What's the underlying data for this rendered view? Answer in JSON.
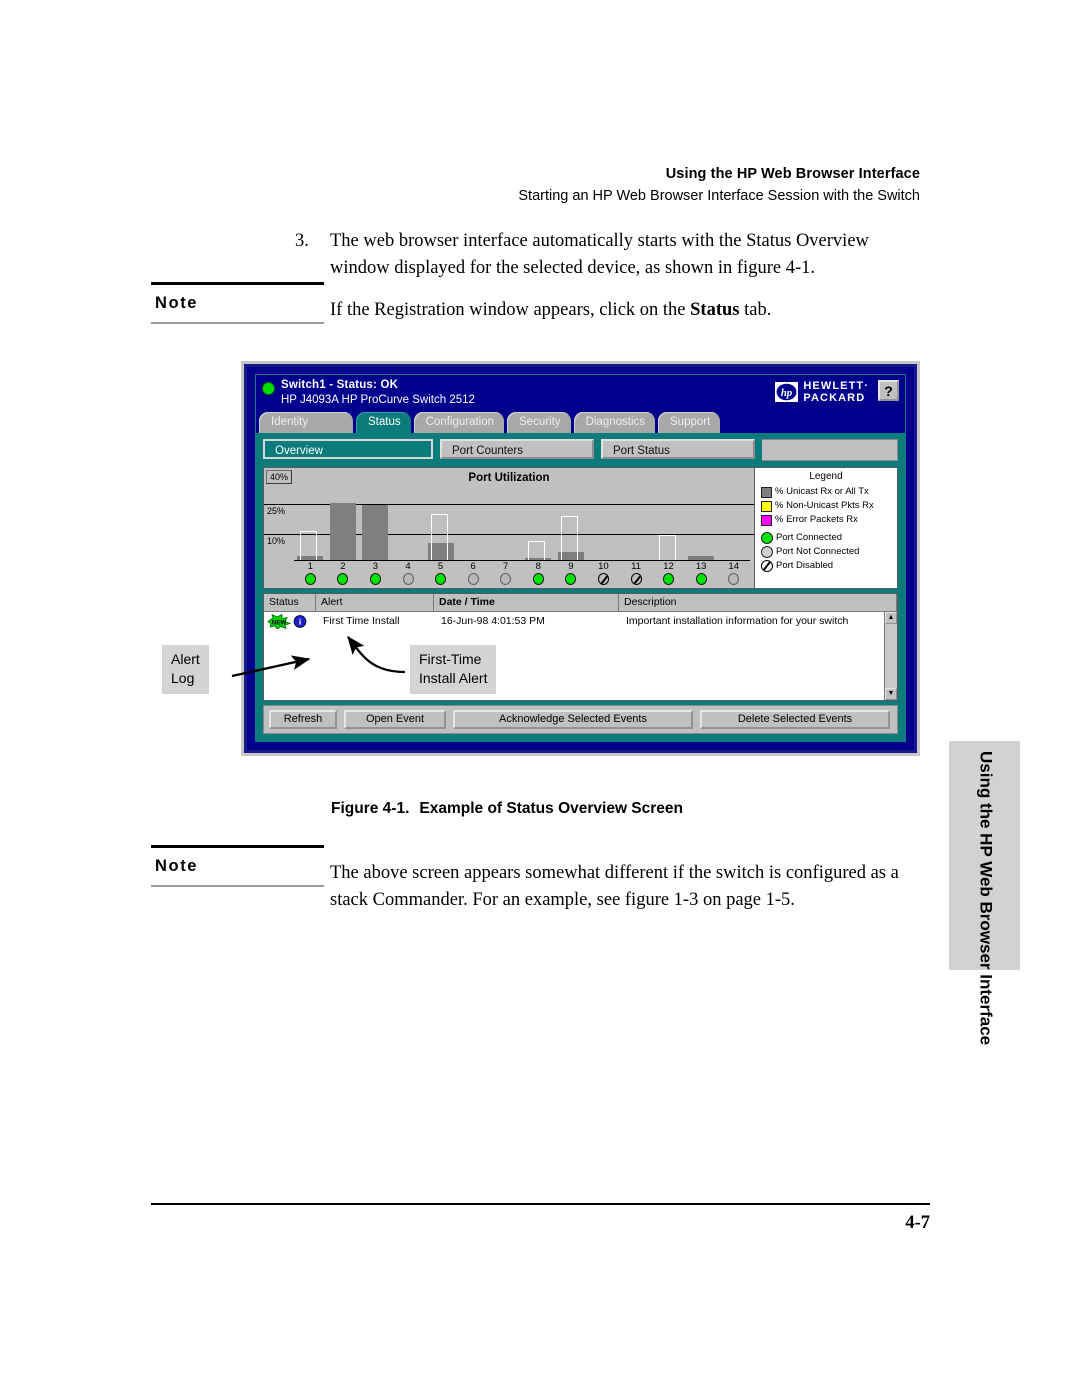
{
  "running_head": {
    "line1": "Using the HP Web Browser Interface",
    "line2": "Starting an HP Web Browser Interface Session with the Switch"
  },
  "step": {
    "number": "3.",
    "text_before": "The web browser interface automatically starts with the Status Overview window displayed for the selected device, as shown in figure 4-1."
  },
  "note_top": {
    "label": "Note",
    "text_a": "If the Registration window appears, click on the ",
    "emphasis": "Status",
    "text_b": " tab."
  },
  "note_bottom": {
    "label": "Note",
    "text": "The above screen appears somewhat different if the switch is configured as a stack Commander. For an example, see figure 1-3 on page 1-5."
  },
  "figure": {
    "caption_number": "Figure 4-1.",
    "caption_title": "Example of Status Overview Screen",
    "callouts": {
      "alert_log": "Alert\nLog",
      "first_time_install": "First-Time\nInstall Alert"
    }
  },
  "screen": {
    "title_line1": "Switch1 - Status: OK",
    "title_line2": "HP J4093A HP ProCurve Switch  2512",
    "brand_line1": "HEWLETT·",
    "brand_line2": "PACKARD",
    "help_label": "?",
    "status_led_color": "#00e000",
    "titlebar_color": "#00008c",
    "accent_color": "#0b7b7b",
    "tabs": [
      {
        "label": "Identity",
        "active": false
      },
      {
        "label": "Status",
        "active": true
      },
      {
        "label": "Configuration",
        "active": false
      },
      {
        "label": "Security",
        "active": false
      },
      {
        "label": "Diagnostics",
        "active": false
      },
      {
        "label": "Support",
        "active": false
      }
    ],
    "subtabs": [
      {
        "label": "Overview",
        "active": true
      },
      {
        "label": "Port Counters",
        "active": false
      },
      {
        "label": "Port Status",
        "active": false
      }
    ],
    "alert_table": {
      "columns": [
        "Status",
        "Alert",
        "Date / Time",
        "Description"
      ],
      "rows": [
        {
          "status_badge": "NEW",
          "alert": "First Time Install",
          "datetime": "16-Jun-98 4:01:53 PM",
          "description": "Important installation information for your switch"
        }
      ]
    },
    "buttons": [
      {
        "label": "Refresh"
      },
      {
        "label": "Open Event"
      },
      {
        "label": "Acknowledge Selected Events"
      },
      {
        "label": "Delete Selected Events"
      }
    ]
  },
  "chart_data": {
    "type": "bar",
    "title": "Port Utilization",
    "xlabel": "",
    "ylabel": "",
    "ylim": [
      0,
      40
    ],
    "ytick_labels": [
      "40%",
      "25%",
      "10%"
    ],
    "yticks": [
      40,
      25,
      10
    ],
    "grid": true,
    "categories": [
      "1",
      "2",
      "3",
      "4",
      "5",
      "6",
      "7",
      "8",
      "9",
      "10",
      "11",
      "12",
      "13",
      "14"
    ],
    "series": [
      {
        "name": "% Unicast Rx or All Tx",
        "color": "#7f7f7f",
        "values": [
          2,
          27,
          26,
          0,
          8,
          0,
          0,
          1,
          4,
          0,
          0,
          0,
          2,
          0
        ]
      },
      {
        "name": "% Non-Unicast Pkts Rx",
        "color": "#ffff00",
        "values": [
          0,
          0,
          0,
          0,
          0,
          0,
          0,
          0,
          0,
          0,
          0,
          0,
          0,
          0
        ]
      },
      {
        "name": "% Error Packets Rx",
        "color": "#ff00ff",
        "values": [
          0,
          0,
          0,
          0,
          0,
          0,
          0,
          0,
          0,
          0,
          0,
          0,
          0,
          0
        ]
      },
      {
        "name": "outline (peak marker)",
        "color": "#ffffff",
        "values": [
          14,
          0,
          0,
          0,
          22,
          0,
          0,
          9,
          21,
          0,
          0,
          12,
          0,
          0
        ]
      }
    ],
    "port_states": [
      "connected",
      "connected",
      "connected",
      "not-connected",
      "connected",
      "not-connected",
      "not-connected",
      "connected",
      "connected",
      "disabled",
      "disabled",
      "connected",
      "connected",
      "not-connected"
    ],
    "legend": {
      "title": "Legend",
      "position": "right",
      "entries": [
        {
          "label": "% Unicast Rx or All Tx",
          "marker": "square",
          "color": "#7f7f7f"
        },
        {
          "label": "% Non-Unicast Pkts Rx",
          "marker": "square",
          "color": "#ffff00"
        },
        {
          "label": "% Error Packets Rx",
          "marker": "square",
          "color": "#ff00ff"
        },
        {
          "label": "Port Connected",
          "marker": "circle",
          "color": "#00e500"
        },
        {
          "label": "Port Not Connected",
          "marker": "circle",
          "color": "#d0d0d0"
        },
        {
          "label": "Port Disabled",
          "marker": "circle-slash",
          "color": "#c0c0c0"
        }
      ]
    }
  },
  "side_tab": {
    "text": "Using the HP Web Browser Interface"
  },
  "footer": {
    "page_number": "4-7"
  }
}
